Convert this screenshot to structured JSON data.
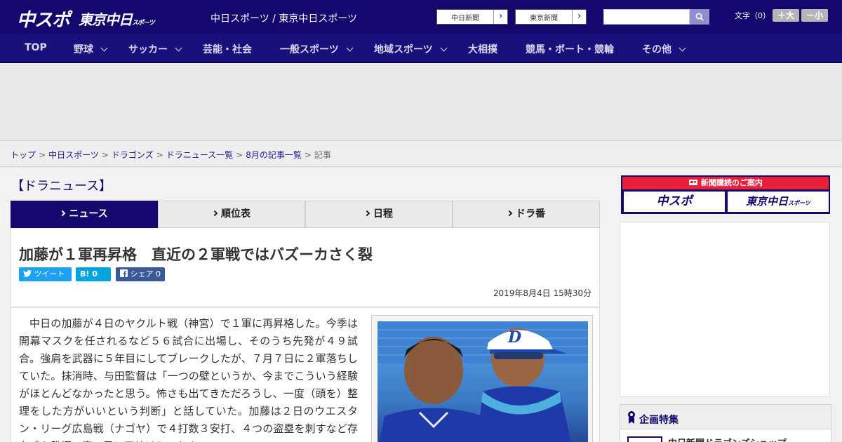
{
  "header": {
    "logo_chunichi_sports": "中スポ",
    "logo_tokyo_chunichi": "東京中日",
    "logo_tokyo_chunichi_suffix": "スポーツ",
    "site_title": "中日スポーツ / 東京中日スポーツ",
    "newspaper_links": [
      "中日新聞",
      "東京新聞"
    ],
    "search_placeholder": "",
    "font_size_label": "文字（0）",
    "font_bigger": "＋大",
    "font_smaller": "－小"
  },
  "nav": {
    "items": [
      {
        "label": "TOP",
        "has_dropdown": false
      },
      {
        "label": "野球",
        "has_dropdown": true
      },
      {
        "label": "サッカー",
        "has_dropdown": true
      },
      {
        "label": "芸能・社会",
        "has_dropdown": false
      },
      {
        "label": "一般スポーツ",
        "has_dropdown": true
      },
      {
        "label": "地域スポーツ",
        "has_dropdown": true
      },
      {
        "label": "大相撲",
        "has_dropdown": false
      },
      {
        "label": "競馬・ボート・競輪",
        "has_dropdown": false
      },
      {
        "label": "その他",
        "has_dropdown": true
      }
    ]
  },
  "breadcrumb": {
    "links": [
      "トップ",
      "中日スポーツ",
      "ドラゴンズ",
      "ドラニュース一覧",
      "8月の記事一覧"
    ],
    "current": "記事",
    "separator": ">"
  },
  "section": {
    "title": "【ドラニュース】",
    "tabs": [
      {
        "label": "ニュース",
        "active": true
      },
      {
        "label": "順位表",
        "active": false
      },
      {
        "label": "日程",
        "active": false
      },
      {
        "label": "ドラ番",
        "active": false
      }
    ]
  },
  "article": {
    "headline": "加藤が１軍再昇格　直近の２軍戦ではバズーカさく裂",
    "share": {
      "tweet": "ツイート",
      "hatena_count": "0",
      "facebook": "シェア",
      "facebook_count": "0"
    },
    "date": "2019年8月4日 15時30分",
    "body": "中日の加藤が４日のヤクルト戦（神宮）で１軍に再昇格した。今季は開幕マスクを任されるなど５６試合に出場し、そのうち先発が４９試合。強肩を武器に５年目にしてブレークしたが、７月７日に２軍落ちしていた。抹消時、与田監督は「一つの壁というか、今までこういう経験がほとんどなかったと思う。怖さも出てきただろうし、一度（頭を）整理をした方がいいという判断」と話していた。加藤は２日のウエスタン・リーグ広島戦（ナゴヤ）で４打数３安打、４つの盗塁を刺すなど存在感を発揮。真っ黒に日焼けし、およ"
  },
  "sidebar": {
    "subscription_banner": "新聞購読のご案内",
    "subscription_pill_1": "中スポ",
    "subscription_pill_2": "東京中日",
    "subscription_pill_2_suffix": "スポーツ",
    "feature_title": "企画特集",
    "feature_item": "中日新聞ドラゴンズショップ"
  },
  "colors": {
    "brand_navy": "#13086e",
    "nav_bg": "#19107b",
    "accent_red": "#ea1f3a",
    "twitter": "#1da1f2",
    "hatena": "#00a4de",
    "facebook": "#3b5998"
  }
}
